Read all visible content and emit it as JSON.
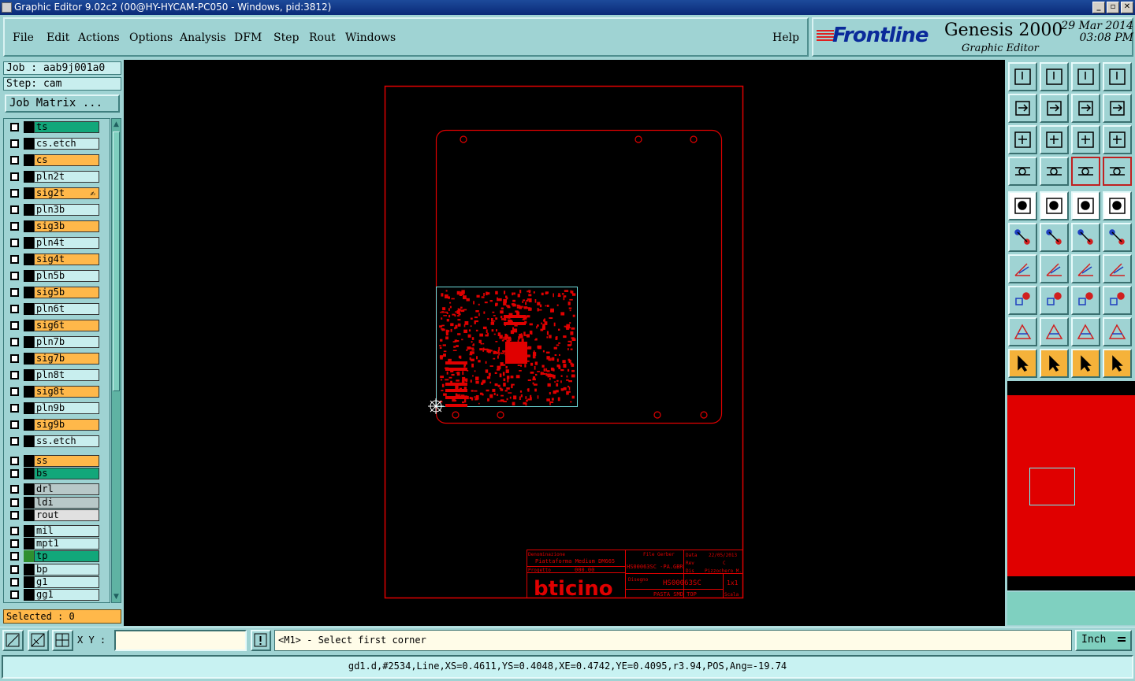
{
  "window": {
    "title": "Graphic Editor 9.02c2 (00@HY-HYCAM-PC050 - Windows, pid:3812)",
    "controls": [
      "_",
      "▫",
      "✕"
    ]
  },
  "menu": {
    "items": [
      "File",
      "Edit",
      "Actions",
      "Options",
      "Analysis",
      "DFM",
      "Step",
      "Rout",
      "Windows"
    ],
    "help": "Help"
  },
  "brand": {
    "logo": "Frontline",
    "product": "Genesis 2000",
    "subtitle": "Graphic Editor",
    "date": "29 Mar 2014",
    "time": "03:08 PM"
  },
  "job": {
    "job_label": "Job : aab9j001a0",
    "step_label": "Step: cam",
    "matrix_button": "Job Matrix ..."
  },
  "layers": [
    {
      "name": "ts",
      "color": "#12a77a",
      "swatch": "#000000",
      "marker": ""
    },
    {
      "name": "cs.etch",
      "color": "#c8eeee",
      "swatch": "#000000",
      "marker": ""
    },
    {
      "name": "cs",
      "color": "#ffb84a",
      "swatch": "#000000",
      "marker": ""
    },
    {
      "name": "pln2t",
      "color": "#c8eeee",
      "swatch": "#000000",
      "marker": ""
    },
    {
      "name": "sig2t",
      "color": "#ffb84a",
      "swatch": "#000000",
      "marker": "✍"
    },
    {
      "name": "pln3b",
      "color": "#c8eeee",
      "swatch": "#000000",
      "marker": ""
    },
    {
      "name": "sig3b",
      "color": "#ffb84a",
      "swatch": "#000000",
      "marker": ""
    },
    {
      "name": "pln4t",
      "color": "#c8eeee",
      "swatch": "#000000",
      "marker": ""
    },
    {
      "name": "sig4t",
      "color": "#ffb84a",
      "swatch": "#000000",
      "marker": ""
    },
    {
      "name": "pln5b",
      "color": "#c8eeee",
      "swatch": "#000000",
      "marker": ""
    },
    {
      "name": "sig5b",
      "color": "#ffb84a",
      "swatch": "#000000",
      "marker": ""
    },
    {
      "name": "pln6t",
      "color": "#c8eeee",
      "swatch": "#000000",
      "marker": ""
    },
    {
      "name": "sig6t",
      "color": "#ffb84a",
      "swatch": "#000000",
      "marker": ""
    },
    {
      "name": "pln7b",
      "color": "#c8eeee",
      "swatch": "#000000",
      "marker": ""
    },
    {
      "name": "sig7b",
      "color": "#ffb84a",
      "swatch": "#000000",
      "marker": ""
    },
    {
      "name": "pln8t",
      "color": "#c8eeee",
      "swatch": "#000000",
      "marker": ""
    },
    {
      "name": "sig8t",
      "color": "#ffb84a",
      "swatch": "#000000",
      "marker": ""
    },
    {
      "name": "pln9b",
      "color": "#c8eeee",
      "swatch": "#000000",
      "marker": ""
    },
    {
      "name": "sig9b",
      "color": "#ffb84a",
      "swatch": "#000000",
      "marker": ""
    },
    {
      "name": "ss.etch",
      "color": "#c8eeee",
      "swatch": "#000000",
      "marker": ""
    },
    {
      "name": "ss",
      "color": "#ffb84a",
      "swatch": "#000000",
      "marker": ""
    },
    {
      "name": "bs",
      "color": "#12a77a",
      "swatch": "#000000",
      "marker": ""
    },
    {
      "name": "drl",
      "color": "#b8c8c8",
      "swatch": "#000000",
      "marker": ""
    },
    {
      "name": "ldi",
      "color": "#b8c8c8",
      "swatch": "#000000",
      "marker": ""
    },
    {
      "name": "rout",
      "color": "#e0e0e0",
      "swatch": "#000000",
      "marker": ""
    },
    {
      "name": "mil",
      "color": "#c8eeee",
      "swatch": "#000000",
      "marker": ""
    },
    {
      "name": "mpt1",
      "color": "#c8eeee",
      "swatch": "#000000",
      "marker": ""
    },
    {
      "name": "tp",
      "color": "#12a77a",
      "swatch": "#2f8f2f",
      "marker": ""
    },
    {
      "name": "bp",
      "color": "#c8eeee",
      "swatch": "#000000",
      "marker": ""
    },
    {
      "name": "g1",
      "color": "#c8eeee",
      "swatch": "#000000",
      "marker": ""
    },
    {
      "name": "gg1",
      "color": "#c8eeee",
      "swatch": "#000000",
      "marker": ""
    }
  ],
  "selected": "Selected : 0",
  "drawing": {
    "title_block": {
      "denominazione_label": "Denominazione",
      "denominazione": "Piattaforma Medium DM665",
      "progetto_label": "Progetto",
      "progetto": "000.00",
      "file_gerber_label": "File Gerber",
      "file_gerber": "HS00063SC -PA.GBR",
      "data_label": "Data",
      "data": "22/05/2013",
      "rev_label": "Rev",
      "rev": "C",
      "dis_label": "Dis",
      "dis": "Pizzochero M.",
      "disegno_label": "Disegno",
      "disegno": "HS00063SC",
      "scale_value": "1x1",
      "scale_label": "Scala",
      "desc": "PASTA SMD TOP",
      "brand": "bticino"
    }
  },
  "toolbar": {
    "xy_label": "X Y :",
    "xy_value": "",
    "prompt": "<M1> - Select first corner",
    "units": "Inch"
  },
  "status": "gd1.d,#2534,Line,XS=0.4611,YS=0.4048,XE=0.4742,YE=0.4095,r3.94,POS,Ang=-19.74",
  "colors": {
    "accent_red": "#e00000",
    "board_outline": "#6fdcdc",
    "panel_bg": "#9fd3d3"
  }
}
